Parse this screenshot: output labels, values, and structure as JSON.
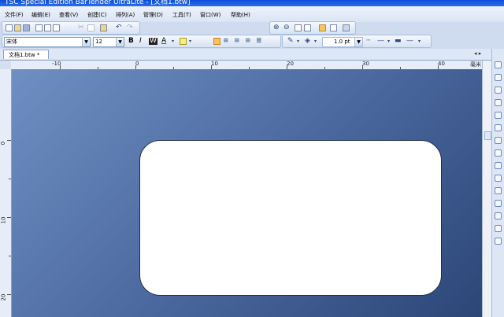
{
  "window": {
    "title": "TSC Special Edition BarTender UltraLite - [文档1.btw]"
  },
  "menu": [
    "文件(F)",
    "编辑(E)",
    "查看(V)",
    "创建(C)",
    "排列(A)",
    "管理(D)",
    "工具(T)",
    "窗口(W)",
    "帮助(H)"
  ],
  "format_toolbar": {
    "font": "宋体",
    "size": "12",
    "bold": "B",
    "italic": "I",
    "outline": "W",
    "font_color": "A",
    "line_width": "1.0 pt"
  },
  "document_tab": {
    "label": "文档1.btw",
    "marker": "*"
  },
  "ruler": {
    "unit": "毫米",
    "h_labels": [
      "-10",
      "0",
      "10",
      "20",
      "30",
      "40"
    ],
    "v_labels": [
      "0",
      "10",
      "20"
    ]
  }
}
